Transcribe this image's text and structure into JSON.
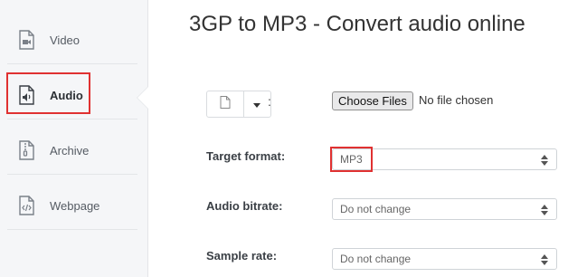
{
  "page": {
    "title": "3GP to MP3 - Convert audio online"
  },
  "sidebar": {
    "items": [
      {
        "label": "Video",
        "icon": "video-file-icon"
      },
      {
        "label": "Audio",
        "icon": "audio-file-icon",
        "active": true
      },
      {
        "label": "Archive",
        "icon": "archive-file-icon"
      },
      {
        "label": "Webpage",
        "icon": "code-file-icon"
      }
    ]
  },
  "upload": {
    "file_icon": "file-icon",
    "dropdown_icon": "caret-down-icon",
    "colon": ":",
    "choose_label": "Choose Files",
    "no_file_text": "No file chosen"
  },
  "form": {
    "target_format": {
      "label": "Target format:",
      "value": "MP3"
    },
    "audio_bitrate": {
      "label": "Audio bitrate:",
      "value": "Do not change"
    },
    "sample_rate": {
      "label": "Sample rate:",
      "value": "Do not change"
    }
  },
  "colors": {
    "highlight": "#e03131",
    "sidebar_bg": "#f5f6f8"
  }
}
